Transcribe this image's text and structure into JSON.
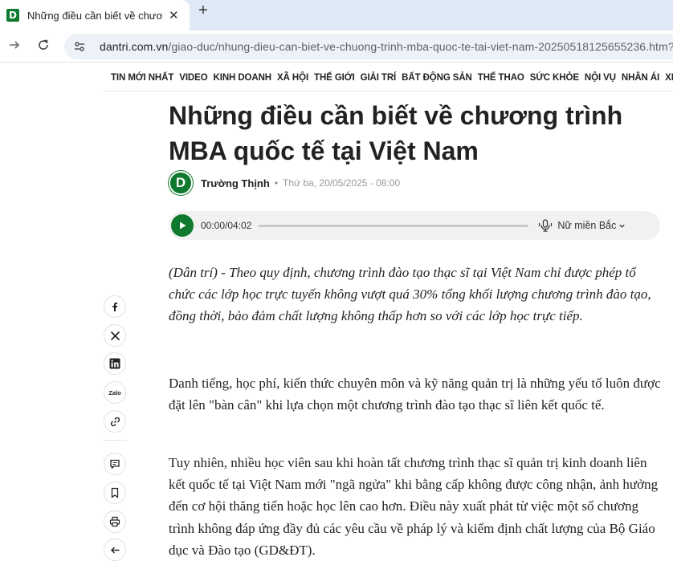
{
  "browser": {
    "tab_title": "Những điều cần biết về chương trình MBA quốc tế tại Việt Nam",
    "favicon_letter": "D",
    "url_host": "dantri.com.vn",
    "url_path": "/giao-duc/nhung-dieu-can-biet-ve-chuong-trinh-mba-quoc-te-tai-viet-nam-20250518125655236.htm?",
    "close_glyph": "✕",
    "new_tab_glyph": "+"
  },
  "nav": {
    "categories": [
      "TIN MỚI NHẤT",
      "VIDEO",
      "KINH DOANH",
      "XÃ HỘI",
      "THẾ GIỚI",
      "GIẢI TRÍ",
      "BẤT ĐỘNG SẢN",
      "THỂ THAO",
      "SỨC KHỎE",
      "NỘI VỤ",
      "NHÂN ÁI",
      "XE"
    ]
  },
  "article": {
    "title": "Những điều cần biết về chương trình MBA quốc tế tại Việt Nam",
    "author_logo": "D",
    "author": "Trường Thịnh",
    "separator": "•",
    "date": "Thứ ba, 20/05/2025 - 08:00",
    "audio": {
      "time": "00:00/04:02",
      "voice": "Nữ miền Bắc",
      "progress": 0
    },
    "sapo": "(Dân trí) - Theo quy định, chương trình đào tạo thạc sĩ tại Việt Nam chỉ được phép tổ chức các lớp học trực tuyến không vượt quá 30% tổng khối lượng chương trình đào tạo, đồng thời, bảo đảm chất lượng không thấp hơn so với các lớp học trực tiếp.",
    "paragraphs": [
      "Danh tiếng, học phí, kiến thức chuyên môn và kỹ năng quản trị là những yếu tố luôn được đặt lên \"bàn cân\" khi lựa chọn một chương trình đào tạo thạc sĩ liên kết quốc tế.",
      "Tuy nhiên, nhiều học viên sau khi hoàn tất chương trình thạc sĩ quản trị kinh doanh liên kết quốc tế tại Việt Nam mới \"ngã ngửa\" khi bằng cấp không được công nhận, ảnh hưởng đến cơ hội thăng tiến hoặc học lên cao hơn. Điều này xuất phát từ việc một số chương trình không đáp ứng đầy đủ các yêu cầu về pháp lý và kiểm định chất lượng của Bộ Giáo dục và Đào tạo (GD&ĐT)."
    ]
  },
  "share": {
    "zalo_label": "Zalo"
  },
  "colors": {
    "brand": "#0f7a2e",
    "tabbar": "#dfe8f7",
    "omnibox": "#edf1f8"
  }
}
